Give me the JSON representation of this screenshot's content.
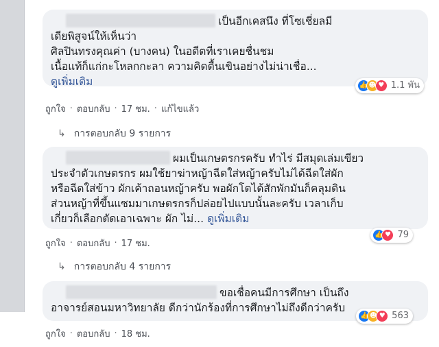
{
  "comments": [
    {
      "lines": [
        "เป็นอีกเคสนึง ที่โซเชี่ยลมี",
        "เดียพิสูจน์ให้เห็นว่า",
        "ศิลปินทรงคุณค่า (บางคน) ในอดีตที่เราเคยชื่นชม",
        "เนื้อแท้ก็แก่กะโหลกกะลา ความคิดตื้นเขินอย่างไม่น่าเชื่อ..."
      ],
      "see_more": "ดูเพิ่มเติม",
      "reaction_count": "1.1 พัน",
      "reaction_icons": [
        "like-icon",
        "haha-icon",
        "love-icon"
      ],
      "actions": {
        "like": "ถูกใจ",
        "reply": "ตอบกลับ",
        "time": "17 ชม.",
        "edited": "แก้ไขแล้ว"
      },
      "replies_label": "การตอบกลับ 9 รายการ"
    },
    {
      "lines": [
        "ผมเป็นเกษตรกรครับ ทำไร่ มีสมุดเล่มเขียว",
        "ประจำตัวเกษตรกร ผมใช้ยาฆ่าหญ้าฉีดใส่หญ้าครับไม่ได้ฉีดใส่ผัก",
        "หรือฉีดใส่ข้าว ผักเค้าถอนหญ้าครับ พอผักโตได้สักพักมันก็คลุมดิน",
        "ส่วนหญ้าที่ขึ้นแซมมาเกษตรกรก็ปล่อยไปแบบนั้นละครับ เวลาเก็บ",
        "เกี่ยวก็เลือกตัดเอาเฉพาะ ผัก ไม่..."
      ],
      "see_more": "ดูเพิ่มเติม",
      "reaction_count": "79",
      "reaction_icons": [
        "like-icon",
        "love-icon"
      ],
      "actions": {
        "like": "ถูกใจ",
        "reply": "ตอบกลับ",
        "time": "17 ชม."
      },
      "replies_label": "การตอบกลับ 4 รายการ"
    },
    {
      "lines": [
        "ขอเชื่อคนมีการศึกษา เป็นถึง",
        "อาจารย์สอนมหาวิทยาลัย ดีกว่านักร้องที่การศึกษาไม่ถึงดีกว่าครับ"
      ],
      "reaction_count": "563",
      "reaction_icons": [
        "like-icon",
        "haha-icon",
        "love-icon"
      ],
      "actions": {
        "like": "ถูกใจ",
        "reply": "ตอบกลับ",
        "time": "18 ชม."
      }
    }
  ]
}
